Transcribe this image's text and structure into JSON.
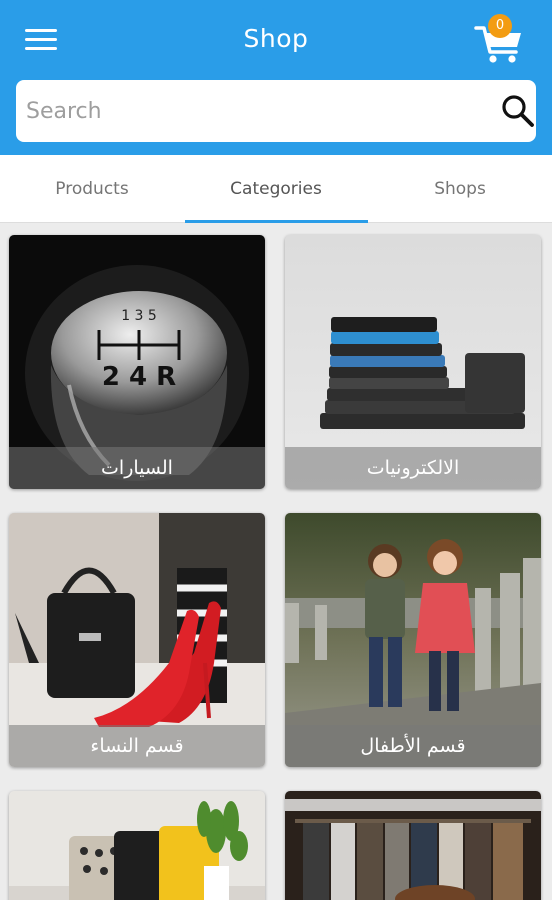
{
  "header": {
    "title": "Shop",
    "menu_icon": "hamburger-menu-icon",
    "cart_icon": "shopping-cart-icon",
    "cart_count": "0",
    "accent_color": "#2a9de8",
    "badge_color": "#f39c12"
  },
  "search": {
    "placeholder": "Search",
    "icon": "search-icon"
  },
  "tabs": [
    {
      "label": "Products"
    },
    {
      "label": "Categories",
      "active": true
    },
    {
      "label": "Shops"
    }
  ],
  "categories": [
    {
      "label": "السيارات",
      "image": "gear-shift-knob"
    },
    {
      "label": "الالكترونيات",
      "image": "stacked-phones"
    },
    {
      "label": "قسم النساء",
      "image": "handbag-and-red-heels"
    },
    {
      "label": "قسم الأطفال",
      "image": "two-children"
    },
    {
      "label": "",
      "image": "cushions-and-plant"
    },
    {
      "label": "",
      "image": "clothing-rack"
    }
  ]
}
